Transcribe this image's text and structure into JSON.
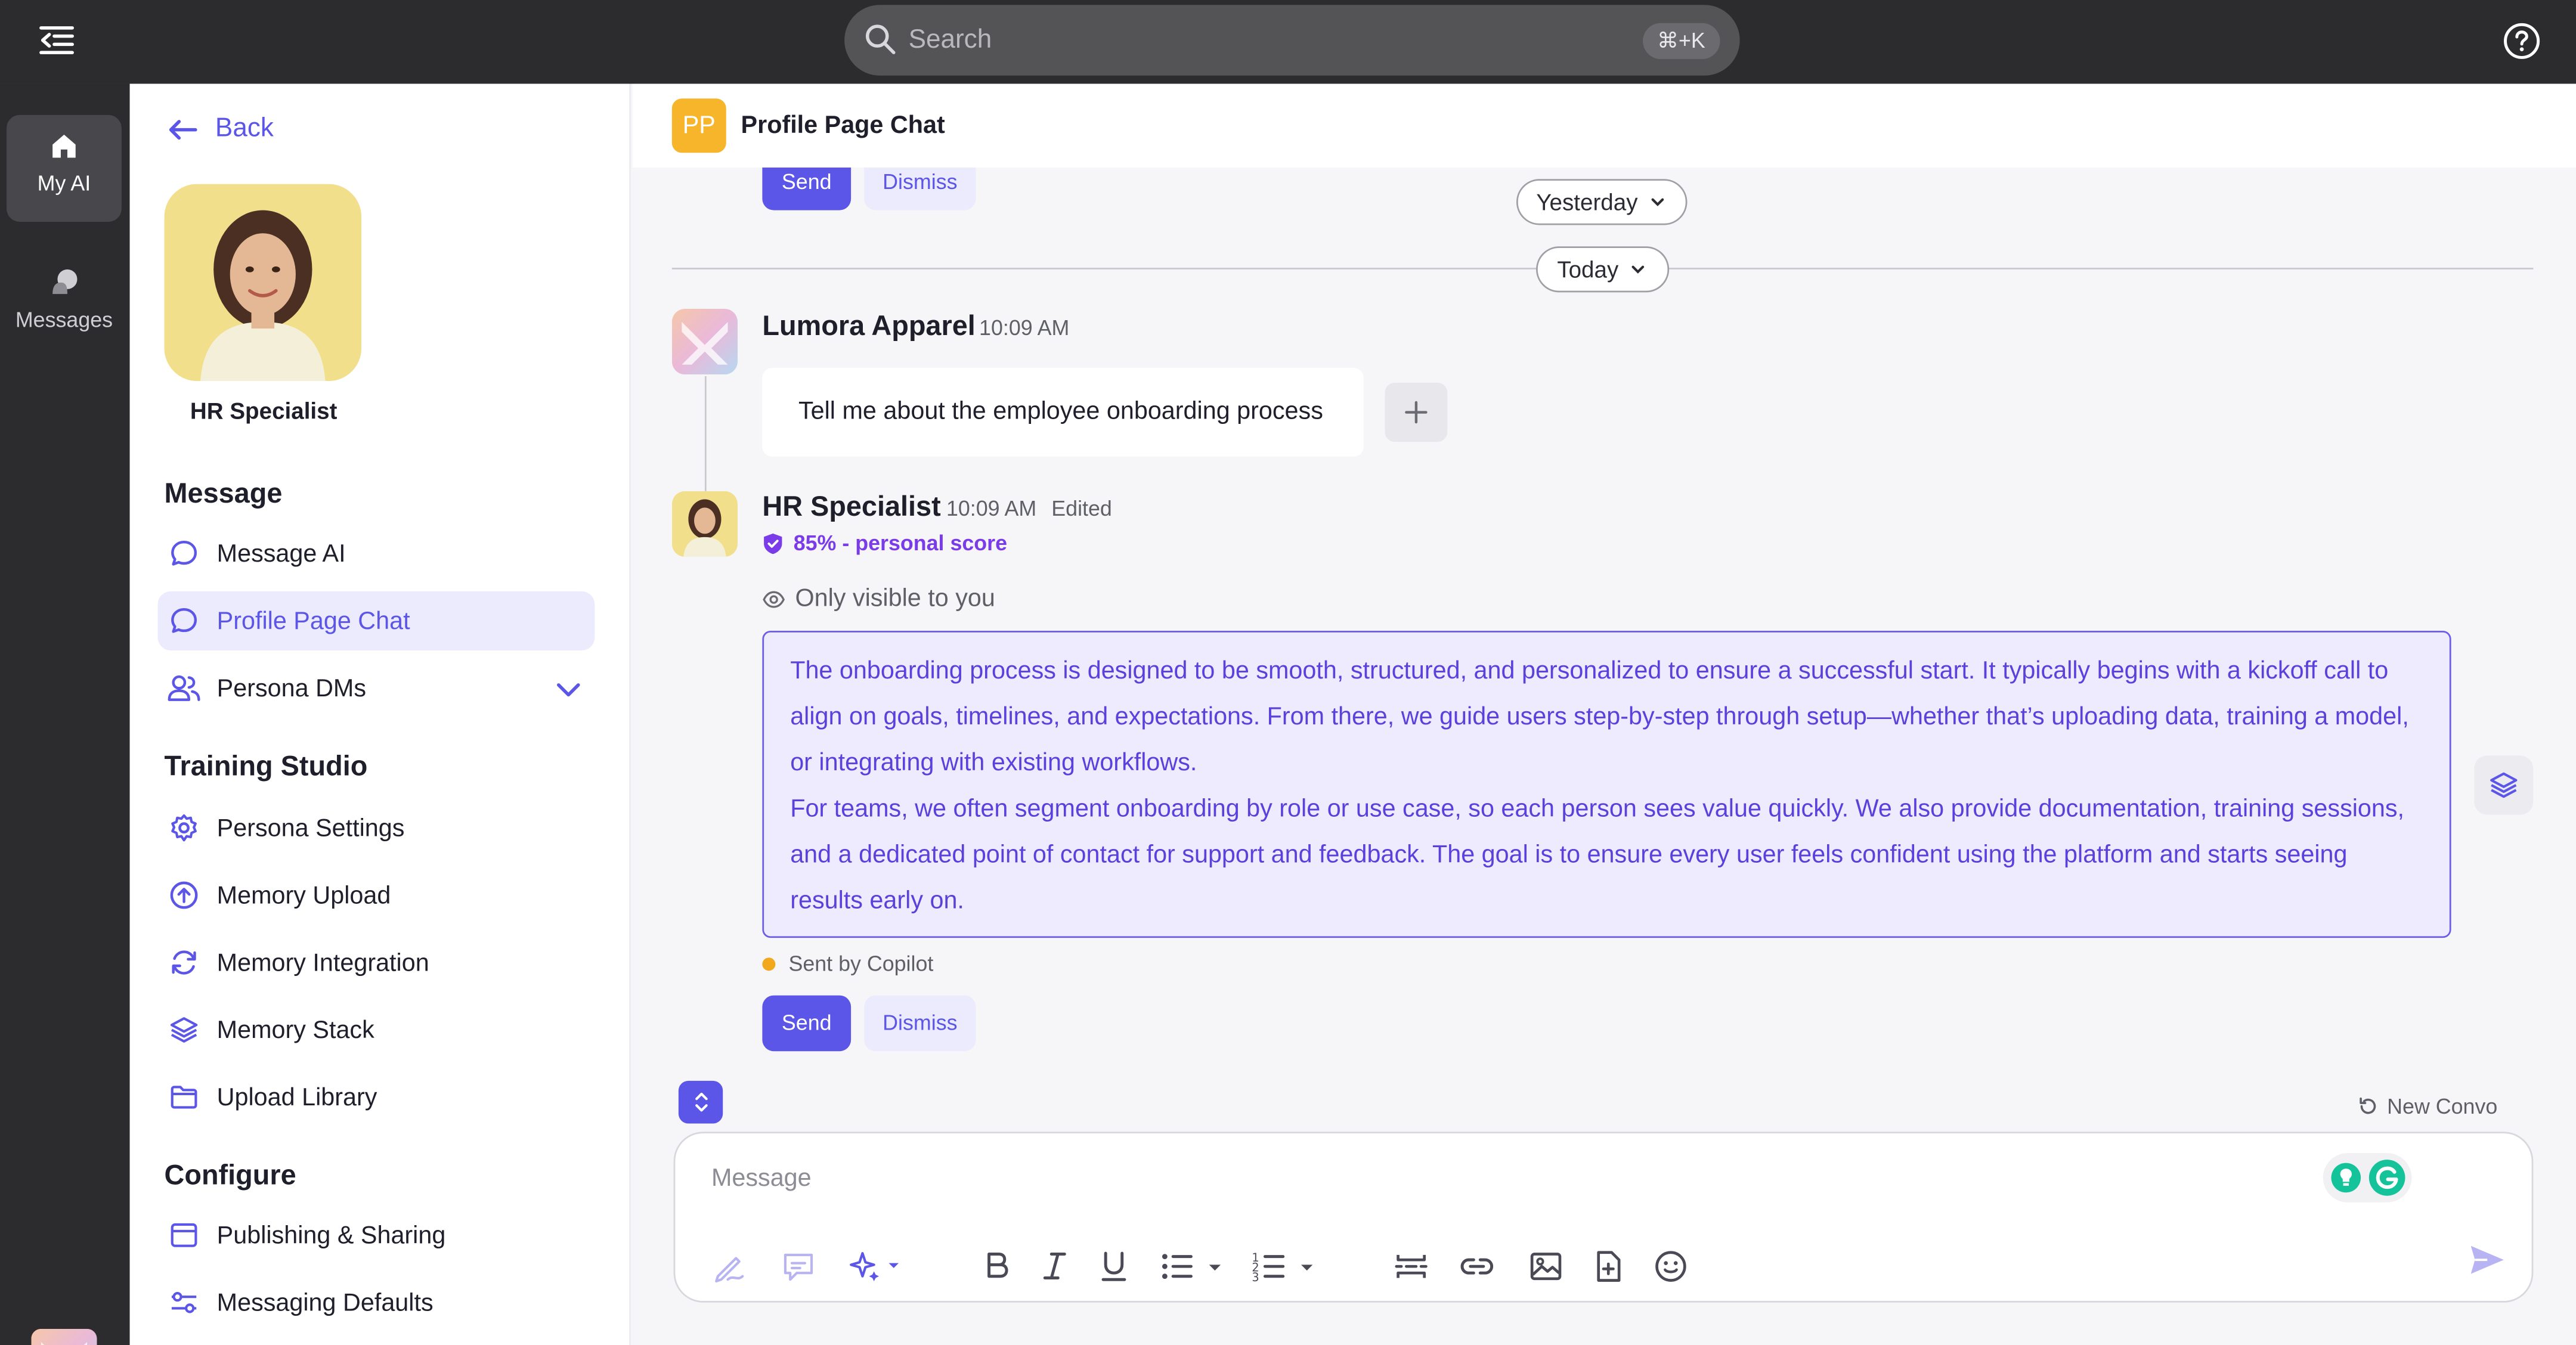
{
  "topbar": {
    "search_placeholder": "Search",
    "search_shortcut": "⌘+K"
  },
  "rail": {
    "items": [
      {
        "label": "My AI",
        "icon": "home-icon",
        "active": true
      },
      {
        "label": "Messages",
        "icon": "messages-icon",
        "active": false
      }
    ]
  },
  "sidebar": {
    "back_label": "Back",
    "persona_name": "HR Specialist",
    "sections": {
      "message": {
        "title": "Message",
        "items": [
          {
            "label": "Message AI",
            "icon": "chat-bubble-icon"
          },
          {
            "label": "Profile Page Chat",
            "icon": "chat-bubble-icon",
            "active": true
          },
          {
            "label": "Persona DMs",
            "icon": "users-icon",
            "expandable": true
          }
        ]
      },
      "training": {
        "title": "Training Studio",
        "items": [
          {
            "label": "Persona Settings",
            "icon": "gear-icon"
          },
          {
            "label": "Memory Upload",
            "icon": "upload-icon"
          },
          {
            "label": "Memory Integration",
            "icon": "sync-icon"
          },
          {
            "label": "Memory Stack",
            "icon": "layers-icon"
          },
          {
            "label": "Upload Library",
            "icon": "folder-icon"
          }
        ]
      },
      "configure": {
        "title": "Configure",
        "items": [
          {
            "label": "Publishing & Sharing",
            "icon": "window-icon"
          },
          {
            "label": "Messaging Defaults",
            "icon": "sliders-icon"
          }
        ]
      }
    }
  },
  "chat": {
    "badge": "PP",
    "title": "Profile Page Chat",
    "top_send": "Send",
    "top_dismiss": "Dismiss",
    "date_yesterday": "Yesterday",
    "date_today": "Today",
    "user_message": {
      "sender": "Lumora Apparel",
      "time": "10:09 AM",
      "text": "Tell me about the employee onboarding process"
    },
    "ai_message": {
      "sender": "HR Specialist",
      "time": "10:09 AM",
      "edited": "Edited",
      "score": "85% - personal score",
      "visibility": "Only visible to you",
      "paragraph_1": "The onboarding process is designed to be smooth, structured, and personalized to ensure a successful start. It typically begins with a kickoff call to align on goals, timelines, and expectations. From there, we guide users step-by-step through setup—whether that’s uploading data, training a model, or integrating with existing workflows.",
      "paragraph_2": "For teams, we often segment onboarding by role or use case, so each person sees value quickly. We also provide documentation, training sessions, and a dedicated point of contact for support and feedback. The goal is to ensure every user feels confident using the platform and starts seeing results early on.",
      "sent_by": "Sent by Copilot",
      "send": "Send",
      "dismiss": "Dismiss"
    },
    "new_convo": "New Convo",
    "composer_placeholder": "Message"
  },
  "colors": {
    "accent": "#5b55e8",
    "ai_text": "#5b40dc",
    "badge": "#f7b52b",
    "score": "#7a3ce8",
    "dark_chrome": "#2c2c2f"
  }
}
